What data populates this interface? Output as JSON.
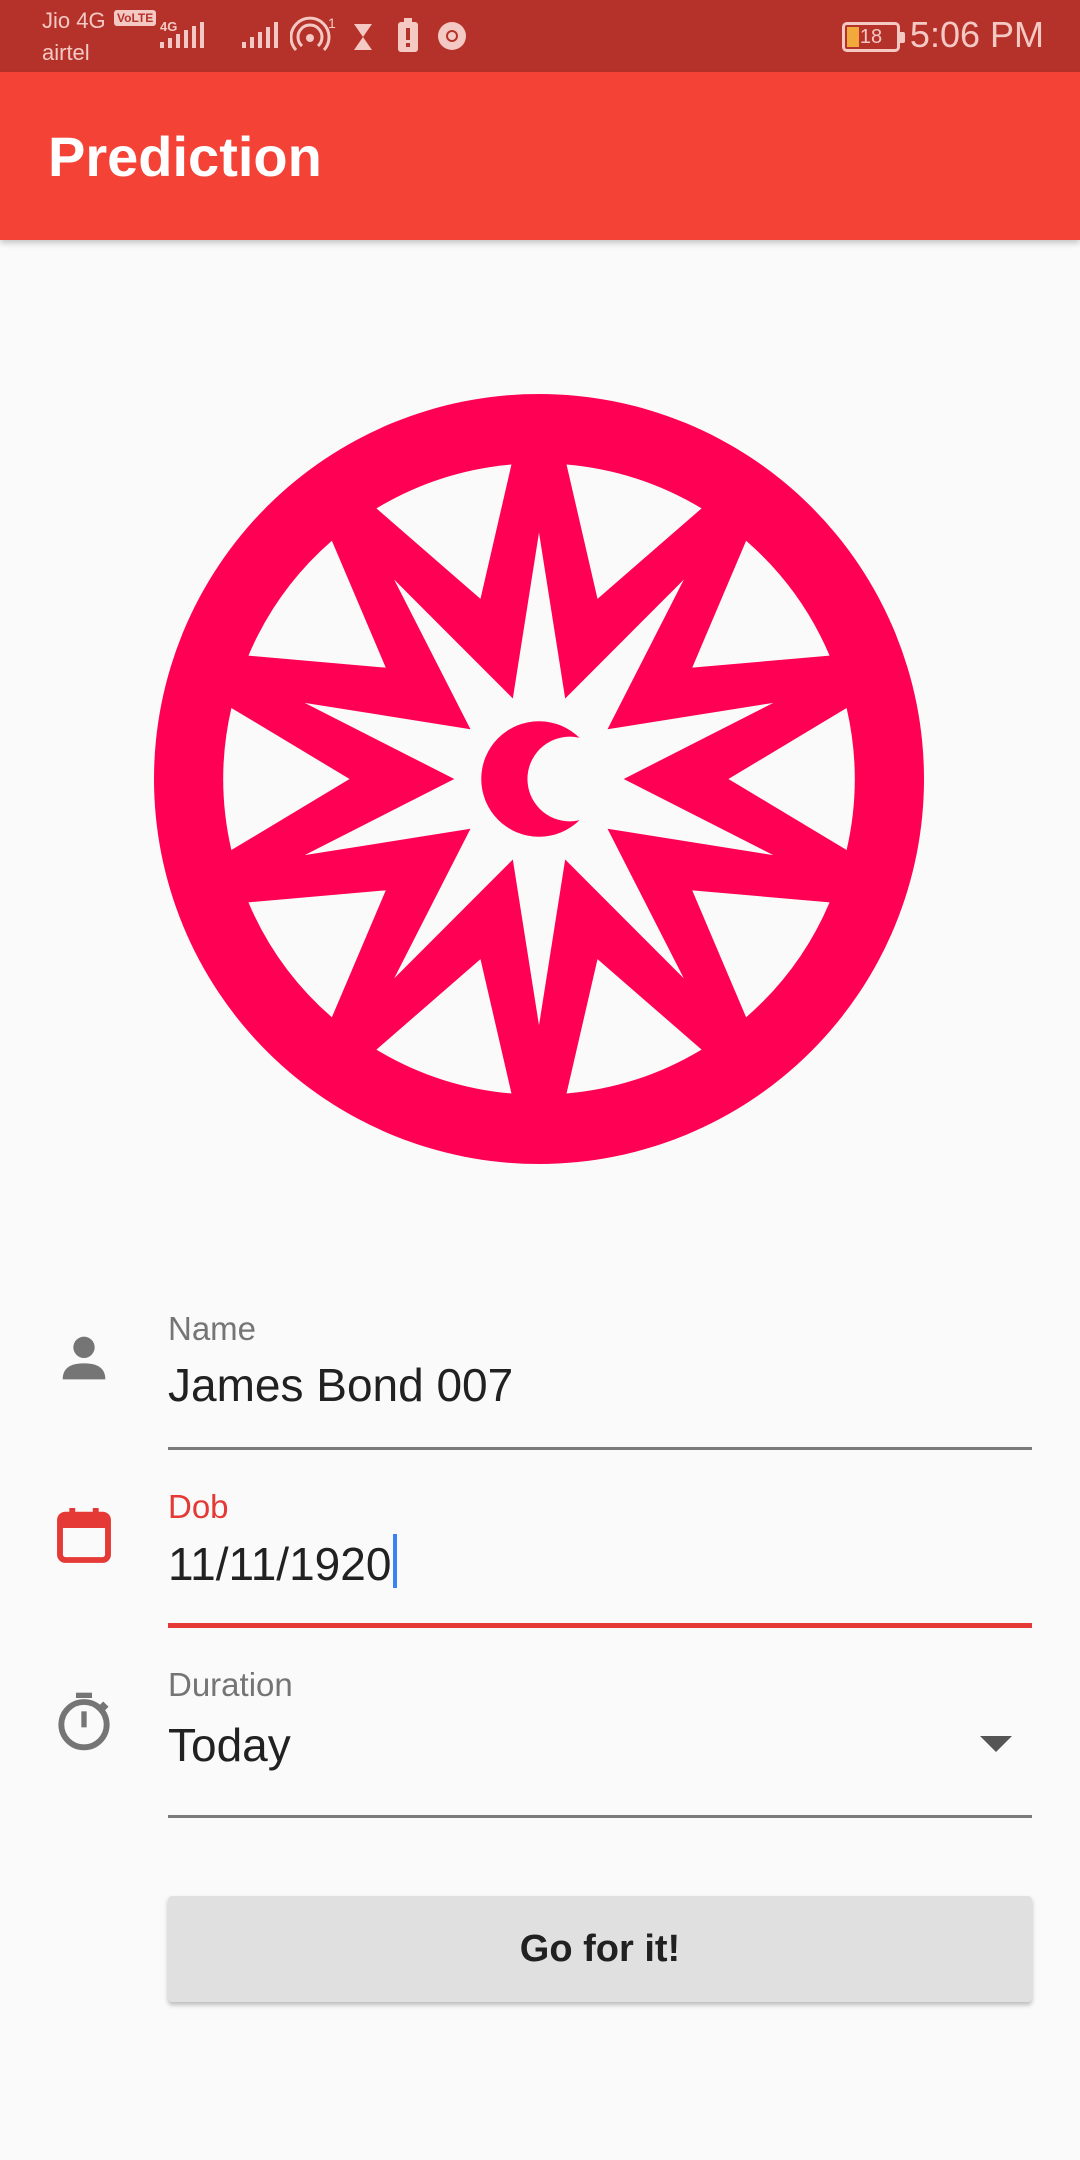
{
  "status_bar": {
    "carrier_1": "Jio 4G",
    "volte": "VoLTE",
    "carrier_2": "airtel",
    "network_4g": "4G",
    "hotspot_count": "1",
    "battery": "18",
    "time": "5:06 PM"
  },
  "app_bar": {
    "title": "Prediction"
  },
  "logo": {
    "icon": "star-moon-logo",
    "color": "#ff0054"
  },
  "form": {
    "name": {
      "icon": "person-icon",
      "label": "Name",
      "value": "James Bond 007"
    },
    "dob": {
      "icon": "calendar-icon",
      "label": "Dob",
      "value": "11/11/1920"
    },
    "duration": {
      "icon": "timer-icon",
      "label": "Duration",
      "value": "Today"
    },
    "submit_label": "Go for it!"
  },
  "colors": {
    "primary": "#f44336",
    "status_bar": "#b5322a",
    "accent": "#e53935",
    "logo": "#ff0054",
    "cursor": "#3b82f6"
  }
}
